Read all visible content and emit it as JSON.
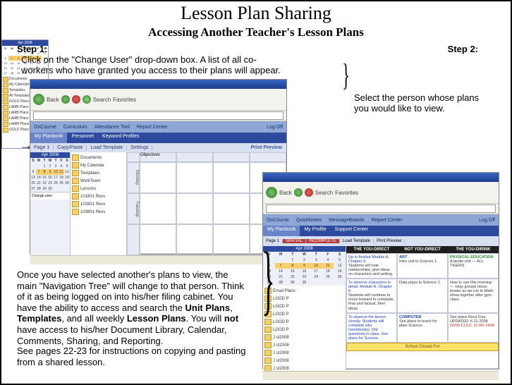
{
  "title": "Lesson Plan Sharing",
  "subtitle": "Accessing Another Teacher's Lesson Plans",
  "step1_label": "Step 1:",
  "step1_text": "Click on the \"Change User\" drop-down box.  A list of all co-workers who have granted you access to their plans will appear.",
  "step2_label": "Step 2:",
  "step2_text": "Select the person whose plans you would like to view.",
  "para1_pre": "Once you have selected another's plans to view, the main \"Navigation Tree\" will change to that person.  Think of it as being logged on into his/her filing cabinet.  You have the ability to access and search the ",
  "para1_b1": "Unit Plans",
  "para1_mid1": ", ",
  "para1_b2": "Templates",
  "para1_mid2": ", and all weekly ",
  "para1_b3": "Lesson Plans",
  "para1_mid3": ". You will ",
  "para1_b4": "not",
  "para1_post": " have access to his/her Document Library, Calendar, Comments, Sharing, and Reporting.",
  "para2": "See pages 22-23 for instructions on copying and pasting from a shared lesson.",
  "ie": {
    "back": "Back",
    "search": "Search",
    "fav": "Favorites"
  },
  "apptabs": {
    "t1": "My Planbook",
    "t2": "Personnel",
    "t3": "Keyword Profiles"
  },
  "subbar": {
    "s1": "Page 1",
    "s2": "Copy/Paste",
    "s3": "Load Template",
    "s4": "Settings",
    "last": "Print Preview"
  },
  "calendar": {
    "month": "Apr 2008",
    "days": [
      "S",
      "M",
      "T",
      "W",
      "T",
      "F",
      "S"
    ],
    "weeks": [
      [
        "",
        "",
        "1",
        "2",
        "3",
        "4",
        "5"
      ],
      [
        "6",
        "7",
        "8",
        "9",
        "10",
        "11",
        "12"
      ],
      [
        "13",
        "14",
        "15",
        "16",
        "17",
        "18",
        "19"
      ],
      [
        "20",
        "21",
        "22",
        "23",
        "24",
        "25",
        "26"
      ],
      [
        "27",
        "28",
        "29",
        "30",
        "",
        "",
        ""
      ]
    ]
  },
  "tree_top_label": "Change user:",
  "tree_items": [
    "Documents",
    "My Calendar",
    "Templates",
    "WorkTeam",
    "Lessons",
    "101801 Revs",
    "102801 Revs",
    "103801 Revs"
  ],
  "grid_headers": [
    "Objectives",
    "",
    "",
    ""
  ],
  "side_labels": [
    "Monday",
    "Tuesday"
  ],
  "mini_tree": [
    "Documents",
    "My Calendar",
    "Templates",
    "All Templates",
    "GOLD Plans",
    "LAMB Plans",
    "LAMB Plans",
    "LAMB Plans",
    "LAMM Plans",
    "GOLD Plans"
  ],
  "shot3": {
    "subtabs": [
      "SPATIAL",
      "INCOMPLETE",
      "Load Template",
      "Print Preview"
    ],
    "headers": [
      "THE YOU-DIRECT",
      "NOT YOU-DIRECT",
      "THE YOU-DIRINK"
    ],
    "row1": [
      {
        "t": "Up to finalize Module A, Chapter 6.",
        "d": "Students will note relationships, give ideas on characters and setting."
      },
      {
        "subj": "ART",
        "cls": "subj-b",
        "d": "Intro unit to Science 1."
      },
      {
        "subj": "PHYSICAL EDUCATION",
        "cls": "subj-g",
        "d": "A tactile unit — ALL TIGERS"
      }
    ],
    "row2": [
      {
        "t": "To observe characters in detail. Module A, Chapter 5.",
        "d": "Students will continue to move forward to complete, final and factual, their ideas."
      },
      {
        "d": "Data plays to Science 1."
      },
      {
        "d": "How to use this morning — relay groups move; tender as we run to Math; show together after gym class."
      }
    ],
    "row3": [
      {
        "t": "To observe the lesson closely. Students will complete wks (workbooks). Old questions in class. See plans for Science."
      },
      {
        "subj": "COMPUTER",
        "cls": "subj-b",
        "d": "See plans to teach for plain Science."
      },
      {
        "subj": "",
        "cls": "subj-r",
        "d": "See plans Revs Five. UPDATED: 6-11-2008",
        "extra": "09/08-CLGS: 11-RE-2008"
      }
    ],
    "yellow": "School Closed For",
    "leftree": [
      "Email Plans",
      "LGOD P",
      "LGOD P",
      "LGOD P",
      "LGOD P",
      "LGOD P",
      "J st2008",
      "J st2008",
      "J st2008",
      "J st2008",
      "J st2008"
    ]
  }
}
